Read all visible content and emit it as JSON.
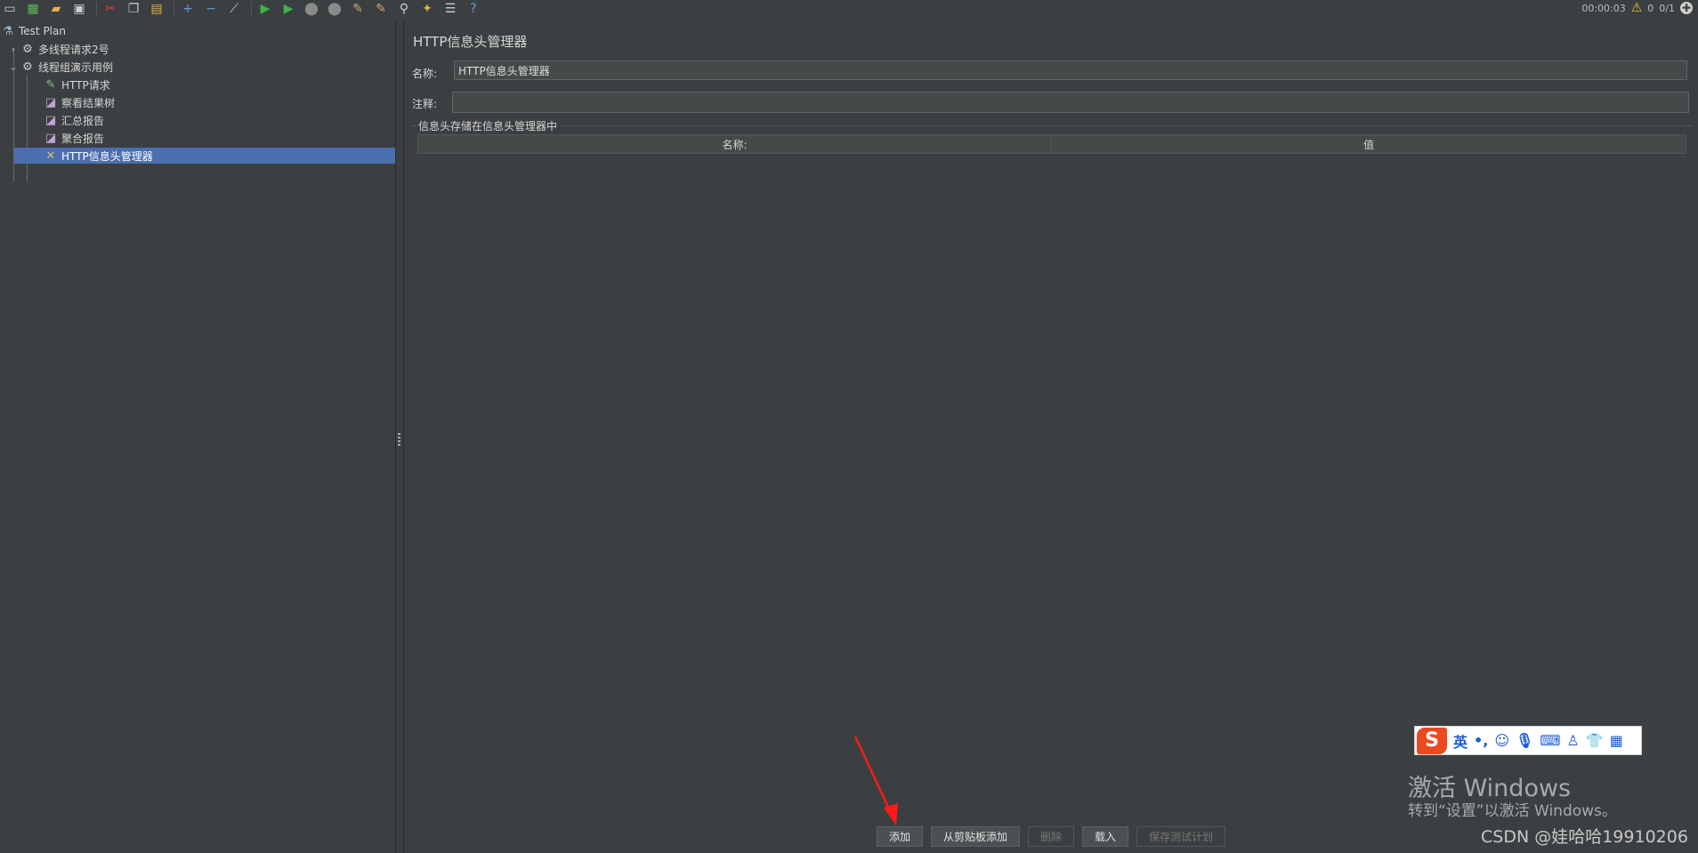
{
  "toolbar": {
    "icons": [
      "new-icon",
      "templates-icon",
      "open-icon",
      "save-icon",
      "cut-icon",
      "copy-icon",
      "paste-icon",
      "expand-icon",
      "collapse-icon",
      "toggle-icon",
      "start-icon",
      "start-no-pause-icon",
      "stop-icon",
      "shutdown-icon",
      "clear-icon",
      "clear-all-icon",
      "search-icon",
      "reset-search-icon",
      "function-helper-icon",
      "help-icon"
    ],
    "elapsed": "00:00:03",
    "warnings": "0",
    "threads": "0/1"
  },
  "tree": {
    "root": "Test Plan",
    "groups": [
      {
        "label": "多线程请求2号",
        "expanded": false
      },
      {
        "label": "线程组演示用例",
        "expanded": true
      }
    ],
    "children": [
      {
        "label": "HTTP请求",
        "icon": "pen-icon"
      },
      {
        "label": "察看结果树",
        "icon": "chart-icon"
      },
      {
        "label": "汇总报告",
        "icon": "chart-icon"
      },
      {
        "label": "聚合报告",
        "icon": "chart-icon"
      },
      {
        "label": "HTTP信息头管理器",
        "icon": "wrench-icon",
        "selected": true
      }
    ]
  },
  "panel": {
    "title": "HTTP信息头管理器",
    "name_label": "名称:",
    "name_value": "HTTP信息头管理器",
    "comment_label": "注释:",
    "comment_value": "",
    "group_title": "信息头存储在信息头管理器中",
    "columns": [
      "名称:",
      "值"
    ]
  },
  "buttons": {
    "add": "添加",
    "add_from_clipboard": "从剪贴板添加",
    "delete": "删除",
    "load": "载入",
    "save_test_plan": "保存测试计划"
  },
  "ime": {
    "mode": "英",
    "punct": "•,"
  },
  "overlay": {
    "activate_title": "激活 Windows",
    "activate_sub": "转到“设置”以激活 Windows。",
    "watermark": "CSDN @娃哈哈19910206"
  },
  "colors": {
    "background": "#3c3f41",
    "selection": "#4b6eaf",
    "annotation_arrow": "#ff1a1a"
  }
}
